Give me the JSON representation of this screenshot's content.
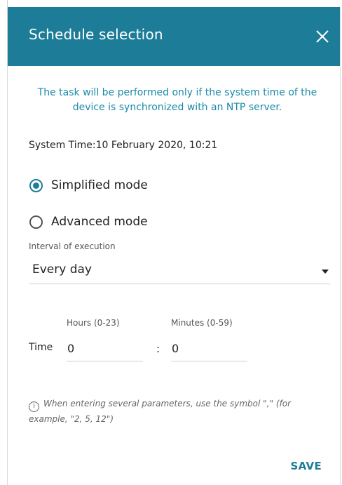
{
  "dialog": {
    "title": "Schedule selection",
    "notice": "The task will be performed only if the system time of the device is synchronized with an NTP server.",
    "system_time": "System Time:10 February 2020, 10:21"
  },
  "modes": {
    "simplified_label": "Simplified mode",
    "advanced_label": "Advanced mode",
    "selected": "Simplified mode"
  },
  "interval": {
    "label": "Interval of execution",
    "value": "Every day"
  },
  "time": {
    "label": "Time",
    "hours_label": "Hours (0-23)",
    "minutes_label": "Minutes (0-59)",
    "hours_value": "0",
    "minutes_value": "0",
    "separator": ":"
  },
  "hint": {
    "icon": "info-icon",
    "text": "When entering several parameters, use the symbol \",\" (for example, \"2, 5, 12\")"
  },
  "actions": {
    "save_label": "SAVE"
  },
  "colors": {
    "accent": "#1d7d98",
    "notice_text": "#1a8aa7"
  }
}
